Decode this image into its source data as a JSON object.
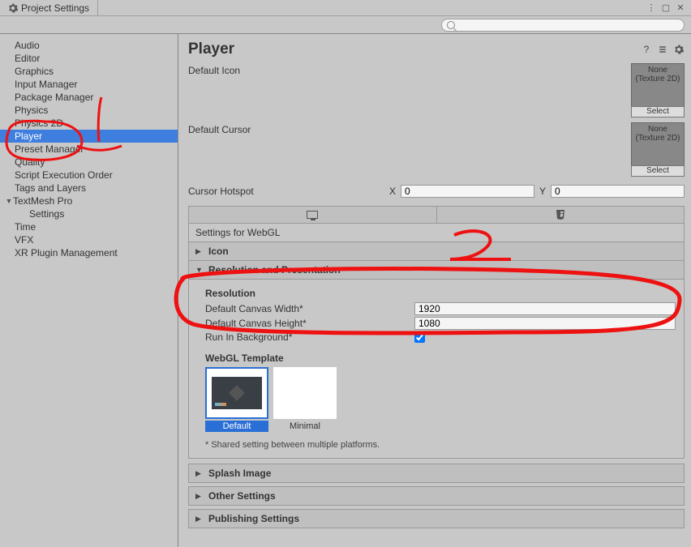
{
  "window": {
    "tab_title": "Project Settings"
  },
  "sidebar": {
    "items": [
      {
        "label": "Audio"
      },
      {
        "label": "Editor"
      },
      {
        "label": "Graphics"
      },
      {
        "label": "Input Manager"
      },
      {
        "label": "Package Manager"
      },
      {
        "label": "Physics"
      },
      {
        "label": "Physics 2D"
      },
      {
        "label": "Player",
        "selected": true
      },
      {
        "label": "Preset Manager"
      },
      {
        "label": "Quality"
      },
      {
        "label": "Script Execution Order"
      },
      {
        "label": "Tags and Layers"
      },
      {
        "label": "TextMesh Pro",
        "expandable": true,
        "expanded": true
      },
      {
        "label": "Settings",
        "child": true
      },
      {
        "label": "Time"
      },
      {
        "label": "VFX"
      },
      {
        "label": "XR Plugin Management"
      }
    ]
  },
  "header": {
    "title": "Player"
  },
  "default_icon": {
    "label": "Default Icon",
    "none": "None",
    "type": "(Texture 2D)",
    "select": "Select"
  },
  "default_cursor": {
    "label": "Default Cursor",
    "none": "None",
    "type": "(Texture 2D)",
    "select": "Select"
  },
  "cursor_hotspot": {
    "label": "Cursor Hotspot",
    "x_label": "X",
    "x_value": "0",
    "y_label": "Y",
    "y_value": "0"
  },
  "settings_for": "Settings for WebGL",
  "sections": {
    "icon": "Icon",
    "resolution_presentation": "Resolution and Presentation",
    "splash": "Splash Image",
    "other": "Other Settings",
    "publishing": "Publishing Settings"
  },
  "resolution": {
    "heading": "Resolution",
    "width_label": "Default Canvas Width*",
    "width_value": "1920",
    "height_label": "Default Canvas Height*",
    "height_value": "1080",
    "run_bg_label": "Run In Background*",
    "run_bg_checked": true
  },
  "webgl_template": {
    "heading": "WebGL Template",
    "default_label": "Default",
    "minimal_label": "Minimal"
  },
  "footnote": "* Shared setting between multiple platforms.",
  "annotations": {
    "label1": "1",
    "label2": "2"
  }
}
